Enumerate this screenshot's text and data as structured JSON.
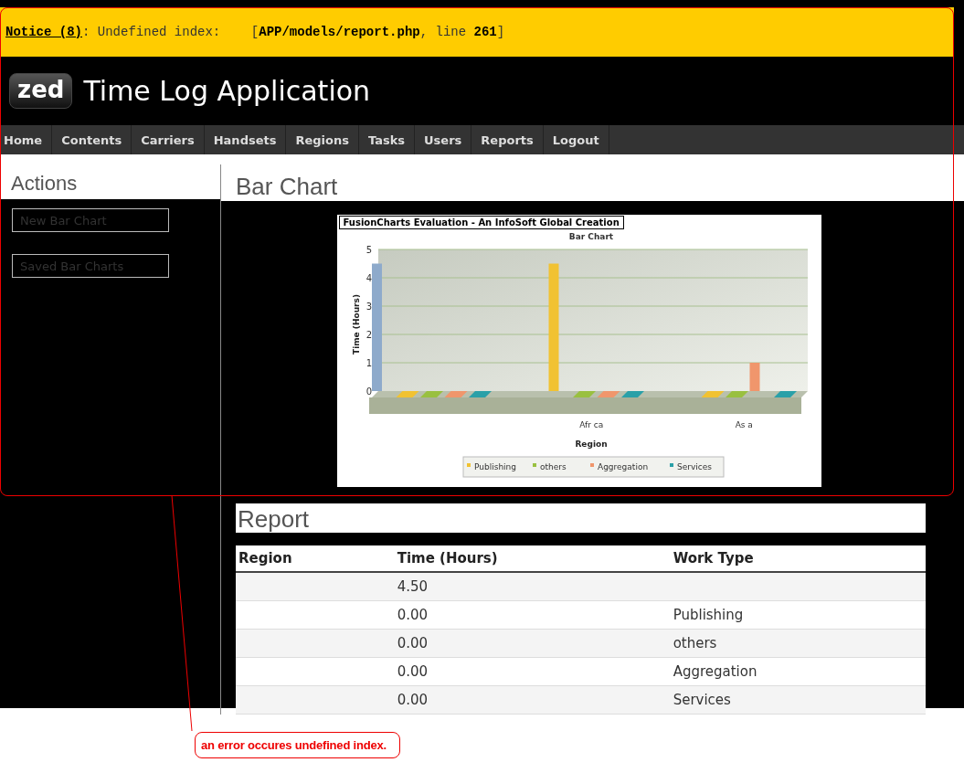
{
  "notice": {
    "label": "Notice (8)",
    "message": ": Undefined index:    [**APP/models/report.php**, line **261**]"
  },
  "header": {
    "logo": "zed",
    "title": "Time Log Application"
  },
  "nav": [
    "Home",
    "Contents",
    "Carriers",
    "Handsets",
    "Regions",
    "Tasks",
    "Users",
    "Reports",
    "Logout"
  ],
  "sidebar": {
    "title": "Actions",
    "buttons": [
      "New Bar Chart",
      "Saved Bar Charts"
    ]
  },
  "chart_section": {
    "title": "Bar Chart",
    "banner": "FusionCharts Evaluation - An InfoSoft Global Creation",
    "chart_data": {
      "type": "bar",
      "title": "Bar Chart",
      "xlabel": "Region",
      "ylabel": "Time (Hours)",
      "categories": [
        null,
        "Afr ca",
        "As a"
      ],
      "grid": true,
      "legend": true,
      "ylim": [
        0,
        5
      ],
      "yticks": [
        0,
        1,
        2,
        3,
        4,
        5
      ],
      "series": [
        {
          "color": "#8eaacb",
          "values": [
            4.5,
            null,
            null
          ]
        },
        {
          "name": "Publishing",
          "color": "#f1c232",
          "values": [
            0,
            4.5,
            0
          ]
        },
        {
          "name": "others",
          "color": "#99c040",
          "values": [
            0,
            0,
            0
          ]
        },
        {
          "name": "Aggregation",
          "color": "#f0966c",
          "values": [
            0,
            0,
            1
          ]
        },
        {
          "name": "Services",
          "color": "#2aa0a8",
          "values": [
            0,
            0,
            0
          ]
        }
      ]
    }
  },
  "report": {
    "title": "Report",
    "columns": [
      "Region",
      "Time (Hours)",
      "Work Type"
    ],
    "rows": [
      {
        "time": "4.50"
      },
      {
        "time": "0.00",
        "work_type": "Publishing"
      },
      {
        "time": "0.00",
        "work_type": "others"
      },
      {
        "time": "0.00",
        "work_type": "Aggregation"
      },
      {
        "time": "0.00",
        "work_type": "Services"
      }
    ]
  },
  "annotation": {
    "text": "an error occures undefined index."
  }
}
